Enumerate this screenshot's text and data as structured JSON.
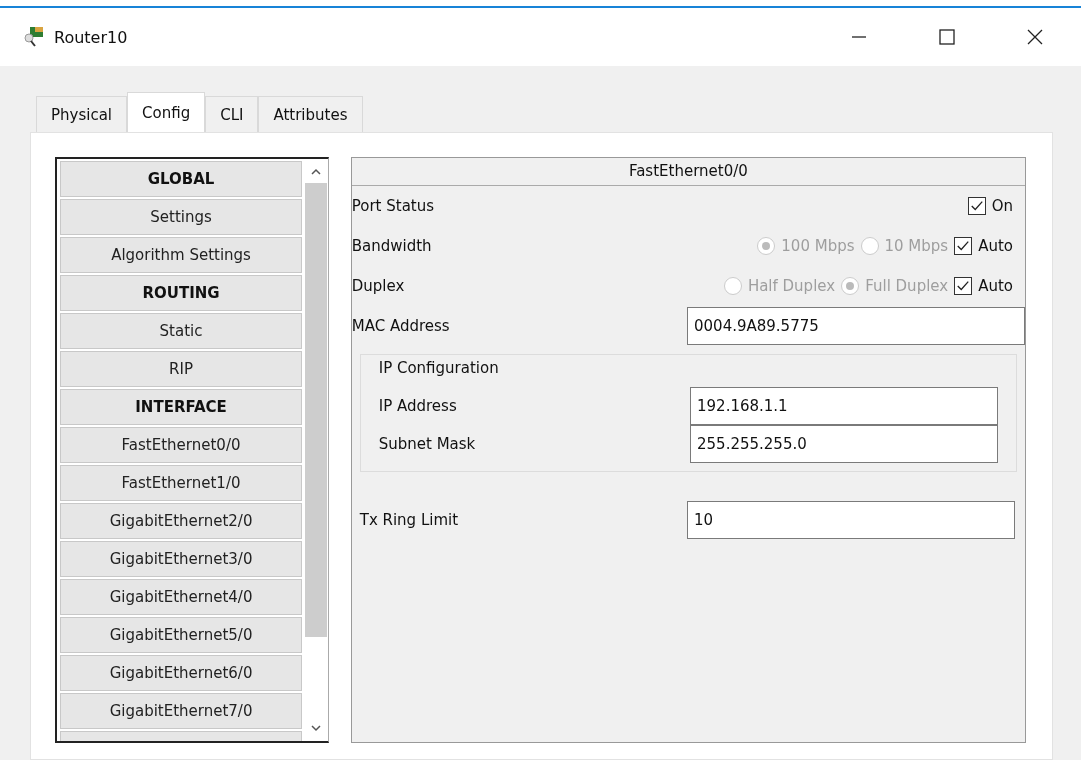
{
  "window": {
    "title": "Router10"
  },
  "tabs": [
    {
      "label": "Physical",
      "selected": false
    },
    {
      "label": "Config",
      "selected": true
    },
    {
      "label": "CLI",
      "selected": false
    },
    {
      "label": "Attributes",
      "selected": false
    }
  ],
  "sidebar": {
    "items": [
      {
        "label": "GLOBAL",
        "kind": "header"
      },
      {
        "label": "Settings",
        "kind": "item"
      },
      {
        "label": "Algorithm Settings",
        "kind": "item"
      },
      {
        "label": "ROUTING",
        "kind": "header"
      },
      {
        "label": "Static",
        "kind": "item"
      },
      {
        "label": "RIP",
        "kind": "item"
      },
      {
        "label": "INTERFACE",
        "kind": "header"
      },
      {
        "label": "FastEthernet0/0",
        "kind": "item"
      },
      {
        "label": "FastEthernet1/0",
        "kind": "item"
      },
      {
        "label": "GigabitEthernet2/0",
        "kind": "item"
      },
      {
        "label": "GigabitEthernet3/0",
        "kind": "item"
      },
      {
        "label": "GigabitEthernet4/0",
        "kind": "item"
      },
      {
        "label": "GigabitEthernet5/0",
        "kind": "item"
      },
      {
        "label": "GigabitEthernet6/0",
        "kind": "item"
      },
      {
        "label": "GigabitEthernet7/0",
        "kind": "item"
      }
    ]
  },
  "panel": {
    "title": "FastEthernet0/0",
    "port_status": {
      "label": "Port Status",
      "option": "On",
      "checked": true
    },
    "bandwidth": {
      "label": "Bandwidth",
      "disabled": true,
      "options": [
        {
          "label": "100 Mbps",
          "selected": true
        },
        {
          "label": "10 Mbps",
          "selected": false
        }
      ],
      "auto": {
        "label": "Auto",
        "checked": true
      }
    },
    "duplex": {
      "label": "Duplex",
      "disabled": true,
      "options": [
        {
          "label": "Half Duplex",
          "selected": false
        },
        {
          "label": "Full Duplex",
          "selected": true
        }
      ],
      "auto": {
        "label": "Auto",
        "checked": true
      }
    },
    "mac_address": {
      "label": "MAC Address",
      "value": "0004.9A89.5775"
    },
    "ip_configuration": {
      "title": "IP Configuration",
      "fields": [
        {
          "label": "IP Address",
          "value": "192.168.1.1"
        },
        {
          "label": "Subnet Mask",
          "value": "255.255.255.0"
        }
      ]
    },
    "tx_ring_limit": {
      "label": "Tx Ring Limit",
      "value": "10"
    }
  }
}
